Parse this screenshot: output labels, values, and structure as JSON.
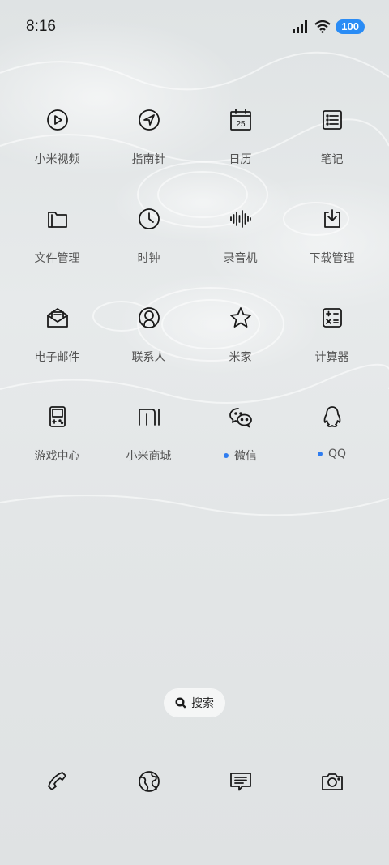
{
  "status_bar": {
    "time": "8:16",
    "battery": "100"
  },
  "apps": [
    {
      "label": "小米视频",
      "icon": "play-circle-icon",
      "badge": false
    },
    {
      "label": "指南针",
      "icon": "compass-icon",
      "badge": false
    },
    {
      "label": "日历",
      "icon": "calendar-icon",
      "date": "25",
      "badge": false
    },
    {
      "label": "笔记",
      "icon": "notes-icon",
      "badge": false
    },
    {
      "label": "文件管理",
      "icon": "folder-icon",
      "badge": false
    },
    {
      "label": "时钟",
      "icon": "clock-icon",
      "badge": false
    },
    {
      "label": "录音机",
      "icon": "waveform-icon",
      "badge": false
    },
    {
      "label": "下载管理",
      "icon": "download-icon",
      "badge": false
    },
    {
      "label": "电子邮件",
      "icon": "mail-icon",
      "badge": false
    },
    {
      "label": "联系人",
      "icon": "contact-icon",
      "badge": false
    },
    {
      "label": "米家",
      "icon": "star-icon",
      "badge": false
    },
    {
      "label": "计算器",
      "icon": "calculator-icon",
      "badge": false
    },
    {
      "label": "游戏中心",
      "icon": "gamepad-icon",
      "badge": false
    },
    {
      "label": "小米商城",
      "icon": "mi-logo-icon",
      "badge": false
    },
    {
      "label": "微信",
      "icon": "wechat-icon",
      "badge": true
    },
    {
      "label": "QQ",
      "icon": "qq-penguin-icon",
      "badge": true
    }
  ],
  "search": {
    "label": "搜索"
  },
  "dock": [
    {
      "icon": "phone-icon"
    },
    {
      "icon": "browser-globe-icon"
    },
    {
      "icon": "messages-icon"
    },
    {
      "icon": "camera-icon"
    }
  ],
  "colors": {
    "badge_dot": "#2f7df0",
    "battery": "#2a8cf5"
  }
}
